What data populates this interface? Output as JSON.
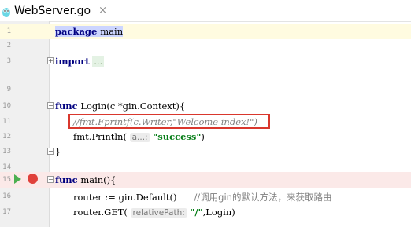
{
  "tab": {
    "label": "WebServer.go",
    "close": "×"
  },
  "lines": [
    {
      "num": "1"
    },
    {
      "num": "2"
    },
    {
      "num": "3"
    },
    {
      "num": "9"
    },
    {
      "num": "10"
    },
    {
      "num": "11"
    },
    {
      "num": "12"
    },
    {
      "num": "13"
    },
    {
      "num": "14"
    },
    {
      "num": "15"
    },
    {
      "num": "16"
    },
    {
      "num": "17"
    }
  ],
  "code": {
    "package_kw": "package",
    "package_name": "main",
    "import_kw": "import",
    "import_folded": "...",
    "func_kw": "func",
    "login_sig": " Login(c *gin.Context){",
    "comment_line": "//fmt.Fprintf(c.Writer,\"Welcome index!\")",
    "println_pre": "fmt.Println(",
    "println_hint": "a...:",
    "println_str": "\"success\"",
    "println_post": ")",
    "close_brace": "}",
    "main_sig": " main(){",
    "router_default": "router := gin.Default()",
    "router_comment": "//调用gin的默认方法，来获取路由",
    "router_get_pre": "router.GET(",
    "router_get_hint": "relativePath:",
    "router_get_str": "\"/\"",
    "router_get_post": ",Login)"
  },
  "colors": {
    "keyword": "#000080",
    "string": "#067d17",
    "comment": "#808080",
    "highlight_box": "#d9372d"
  },
  "icons": {
    "run": "run-icon",
    "breakpoint": "breakpoint-icon",
    "file": "go-gopher-icon"
  }
}
